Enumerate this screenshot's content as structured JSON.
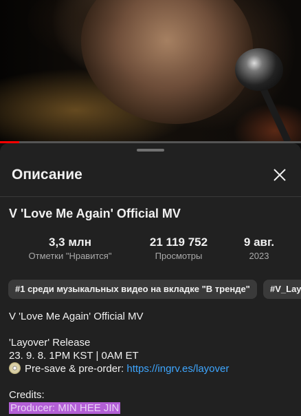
{
  "player": {
    "progress_fraction": 0.065,
    "accent_color": "#ff0000"
  },
  "sheet": {
    "title": "Описание",
    "close_icon": "close-icon"
  },
  "video": {
    "title": "V 'Love Me Again' Official MV",
    "stats": {
      "likes_value": "3,3 млн",
      "likes_label": "Отметки \"Нравится\"",
      "views_value": "21 119 752",
      "views_label": "Просмотры",
      "date_value": "9 авг.",
      "date_label": "2023"
    },
    "chips": [
      "#1 среди музыкальных видео на вкладке \"В тренде\"",
      "#V_Lay"
    ]
  },
  "description": {
    "line1": "V 'Love Me Again' Official MV",
    "line2": "'Layover' Release",
    "line3": "23. 9. 8. 1PM KST | 0AM ET",
    "presave_text": "Pre-save & pre-order: ",
    "presave_link": "https://ingrv.es/layover",
    "presave_icon": "cd-icon",
    "credits_label": "Credits:",
    "producer": "Producer: MIN HEE JIN",
    "highlight_color": "#b35fd6"
  }
}
